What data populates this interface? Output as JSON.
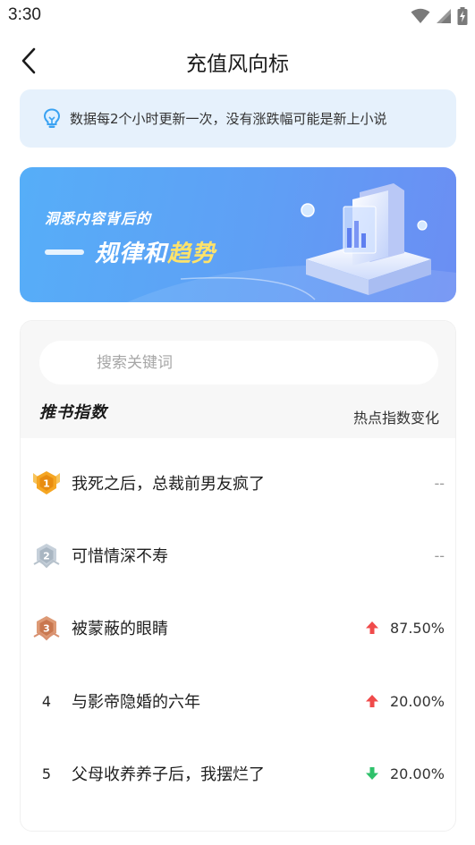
{
  "status_bar": {
    "time": "3:30"
  },
  "header": {
    "title": "充值风向标"
  },
  "notice": {
    "text": "数据每2个小时更新一次，没有涨跌幅可能是新上小说"
  },
  "banner": {
    "line1": "洞悉内容背后的",
    "line2_white": "规律和",
    "line2_yellow": "趋势"
  },
  "search": {
    "placeholder": "搜索关键词",
    "value": ""
  },
  "section": {
    "title": "推书指数",
    "right_label": "热点指数变化"
  },
  "ranking": [
    {
      "rank": "1",
      "title": "我死之后，总裁前男友疯了",
      "trend": "none",
      "change": "--"
    },
    {
      "rank": "2",
      "title": "可惜情深不寿",
      "trend": "none",
      "change": "--"
    },
    {
      "rank": "3",
      "title": "被蒙蔽的眼睛",
      "trend": "up",
      "change": "87.50%"
    },
    {
      "rank": "4",
      "title": "与影帝隐婚的六年",
      "trend": "up",
      "change": "20.00%"
    },
    {
      "rank": "5",
      "title": "父母收养养子后，我摆烂了",
      "trend": "down",
      "change": "20.00%"
    }
  ],
  "colors": {
    "up": "#f04b4b",
    "down": "#2fc16b",
    "gold": "#f5a623",
    "silver": "#a9b6c2",
    "bronze": "#c9774f",
    "accent": "#5ea8f7"
  },
  "icons": {
    "back": "chevron-left-icon",
    "notice": "lightbulb-icon",
    "wifi": "wifi-icon",
    "signal": "signal-icon",
    "battery": "battery-charging-icon"
  }
}
